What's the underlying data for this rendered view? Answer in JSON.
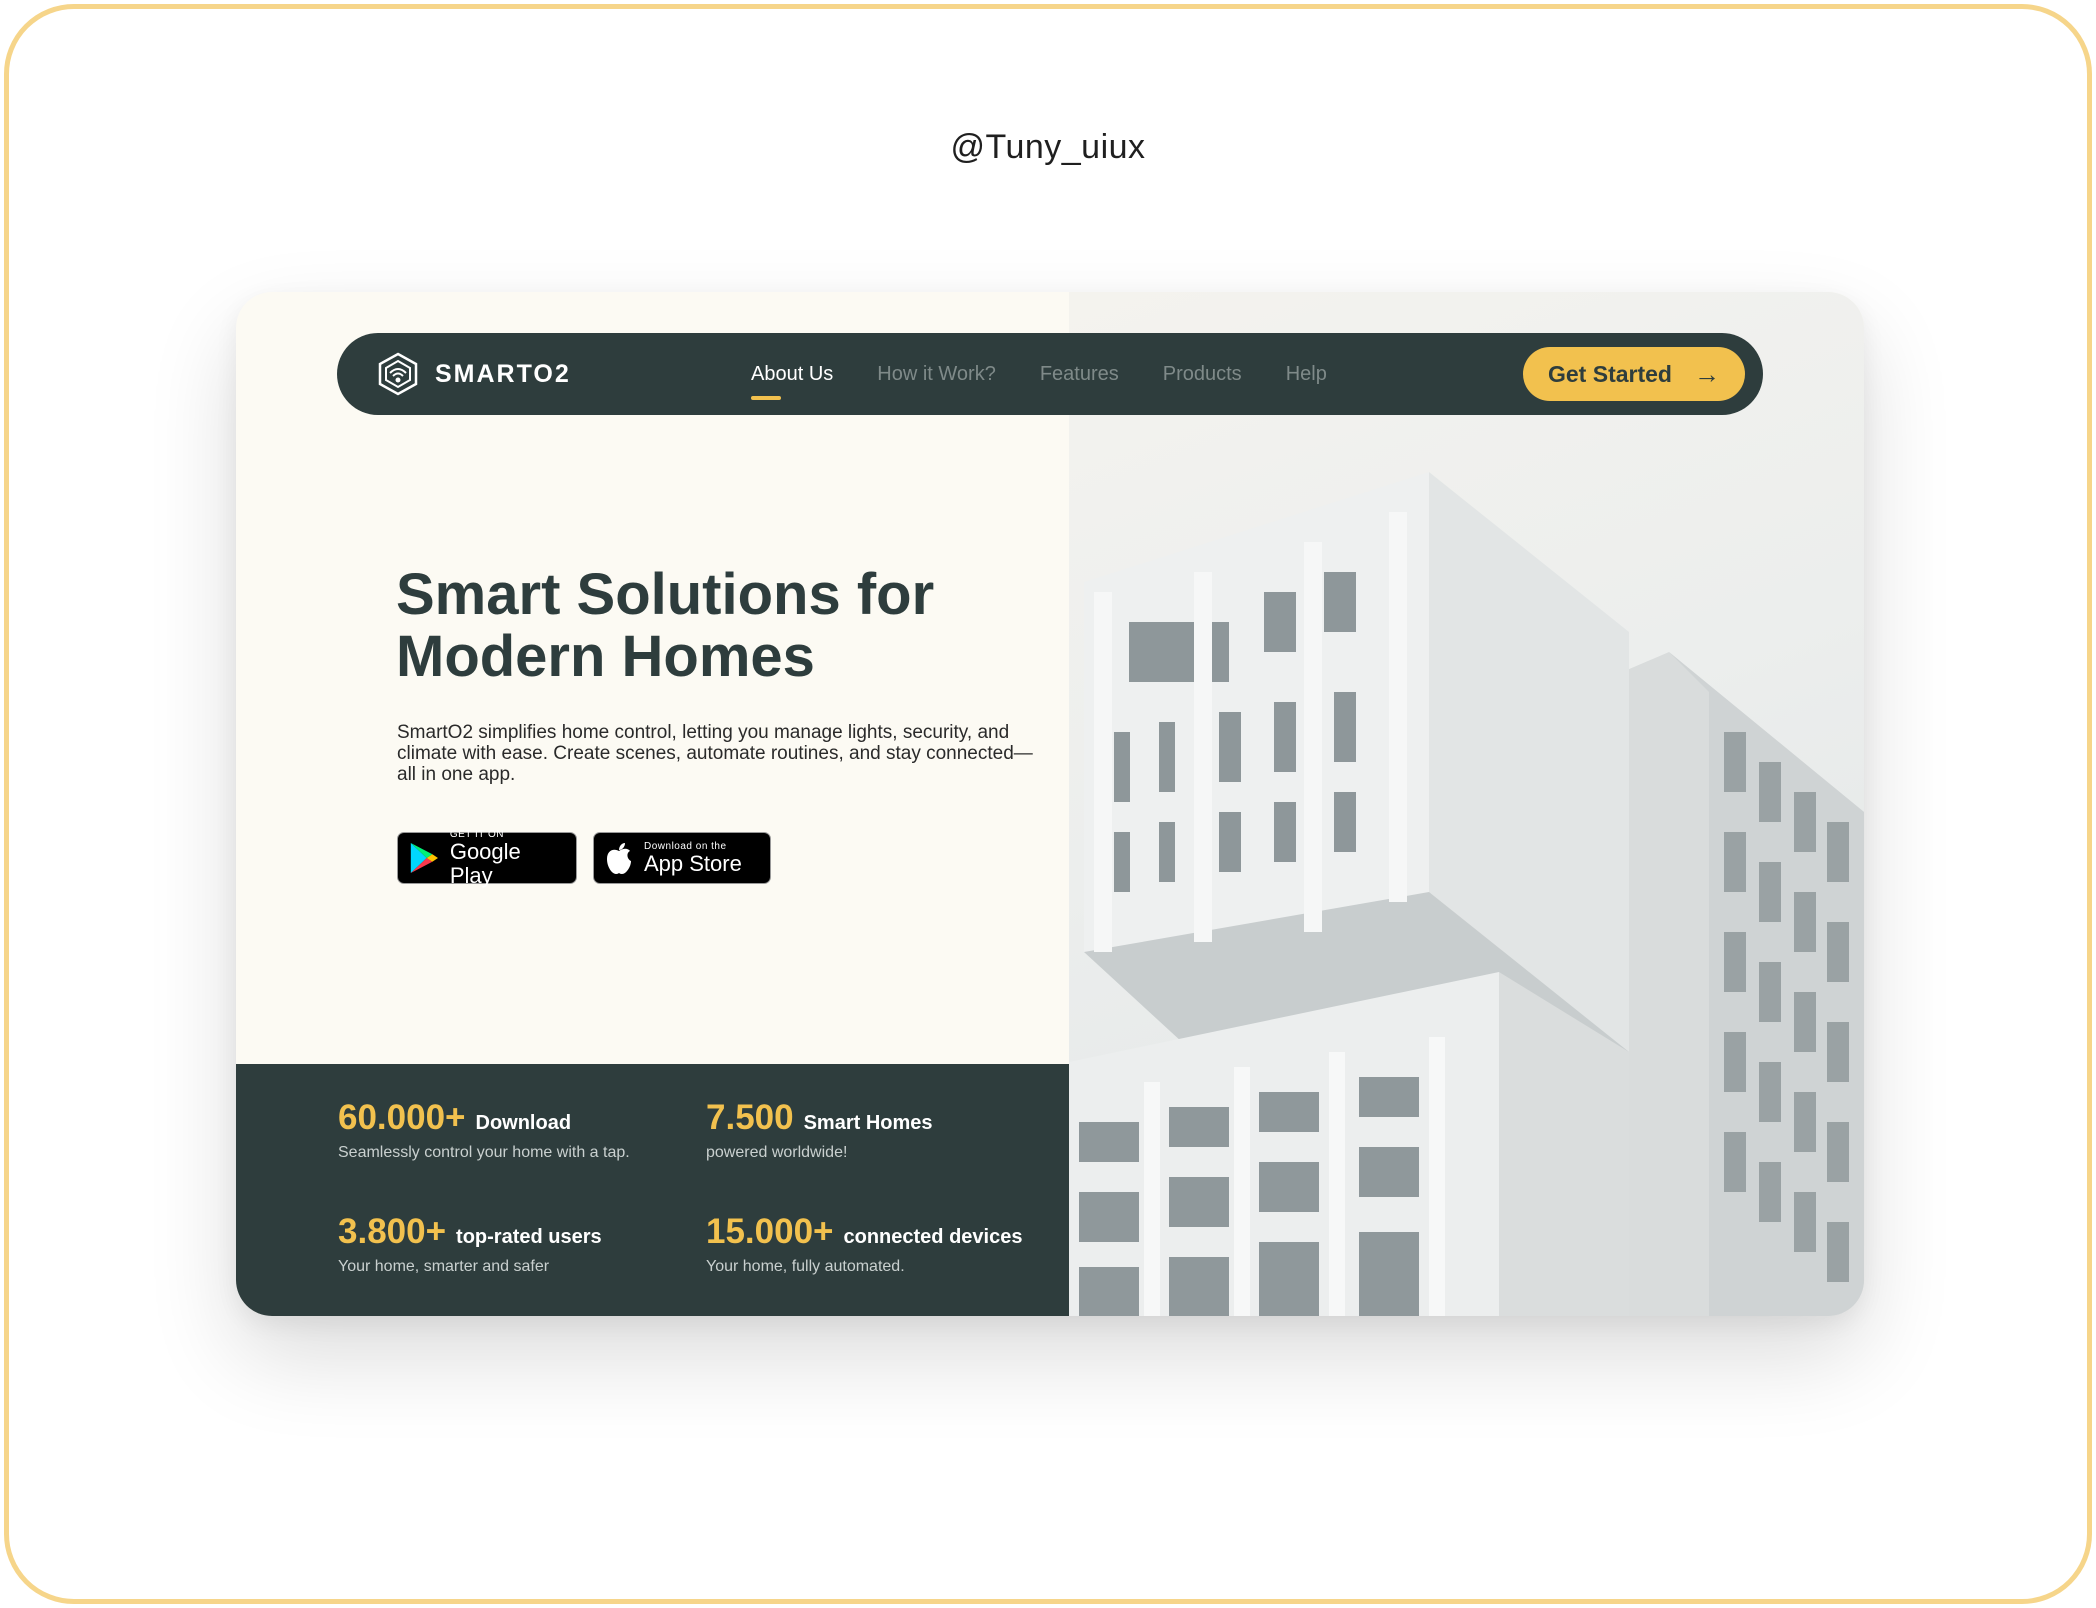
{
  "handle": "@Tuny_uiux",
  "nav": {
    "logo_text": "SMARTO2",
    "items": [
      {
        "label": "About Us",
        "active": true
      },
      {
        "label": "How it Work?",
        "active": false
      },
      {
        "label": "Features",
        "active": false
      },
      {
        "label": "Products",
        "active": false
      },
      {
        "label": "Help",
        "active": false
      }
    ],
    "cta_label": "Get Started"
  },
  "hero": {
    "title_line1": "Smart Solutions for",
    "title_line2": "Modern Homes",
    "description": "SmartO2 simplifies home control, letting you manage lights, security, and climate with ease. Create scenes, automate routines, and stay connected—all in one app."
  },
  "stores": {
    "google": {
      "small": "GET IT ON",
      "big": "Google Play"
    },
    "apple": {
      "small": "Download on the",
      "big": "App Store"
    }
  },
  "stats": [
    {
      "value": "60.000+",
      "label": "Download",
      "sub": "Seamlessly control your home with a tap."
    },
    {
      "value": "7.500",
      "label": "Smart Homes",
      "sub": "powered worldwide!"
    },
    {
      "value": "3.800+",
      "label": "top-rated users",
      "sub": "Your home, smarter and safer"
    },
    {
      "value": "15.000+",
      "label": "connected devices",
      "sub": "Your home, fully automated."
    }
  ],
  "colors": {
    "accent": "#f2c14e",
    "dark": "#2e3d3d",
    "background": "#fcfaf3",
    "frame": "#f6d58a"
  }
}
